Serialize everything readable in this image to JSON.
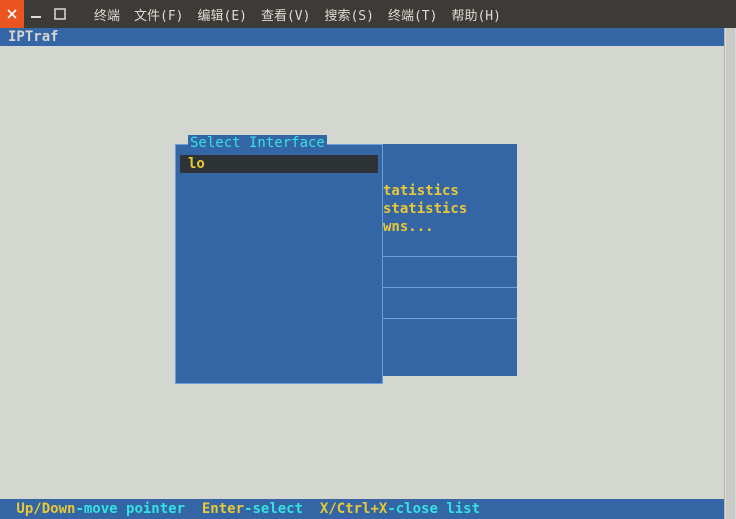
{
  "menu": {
    "items": [
      "终端",
      "文件(F)",
      "编辑(E)",
      "查看(V)",
      "搜索(S)",
      "终端(T)",
      "帮助(H)"
    ]
  },
  "app": {
    "title": "IPTraf"
  },
  "background_menu": {
    "fragments": [
      "tatistics",
      "statistics",
      "wns..."
    ]
  },
  "select_box": {
    "title": "Select Interface",
    "items": [
      "lo"
    ]
  },
  "status": {
    "k1": " Up/Down",
    "d1": "-move pointer  ",
    "k2": "Enter",
    "d2": "-select  ",
    "k3": "X/Ctrl+X",
    "d3": "-close list"
  }
}
